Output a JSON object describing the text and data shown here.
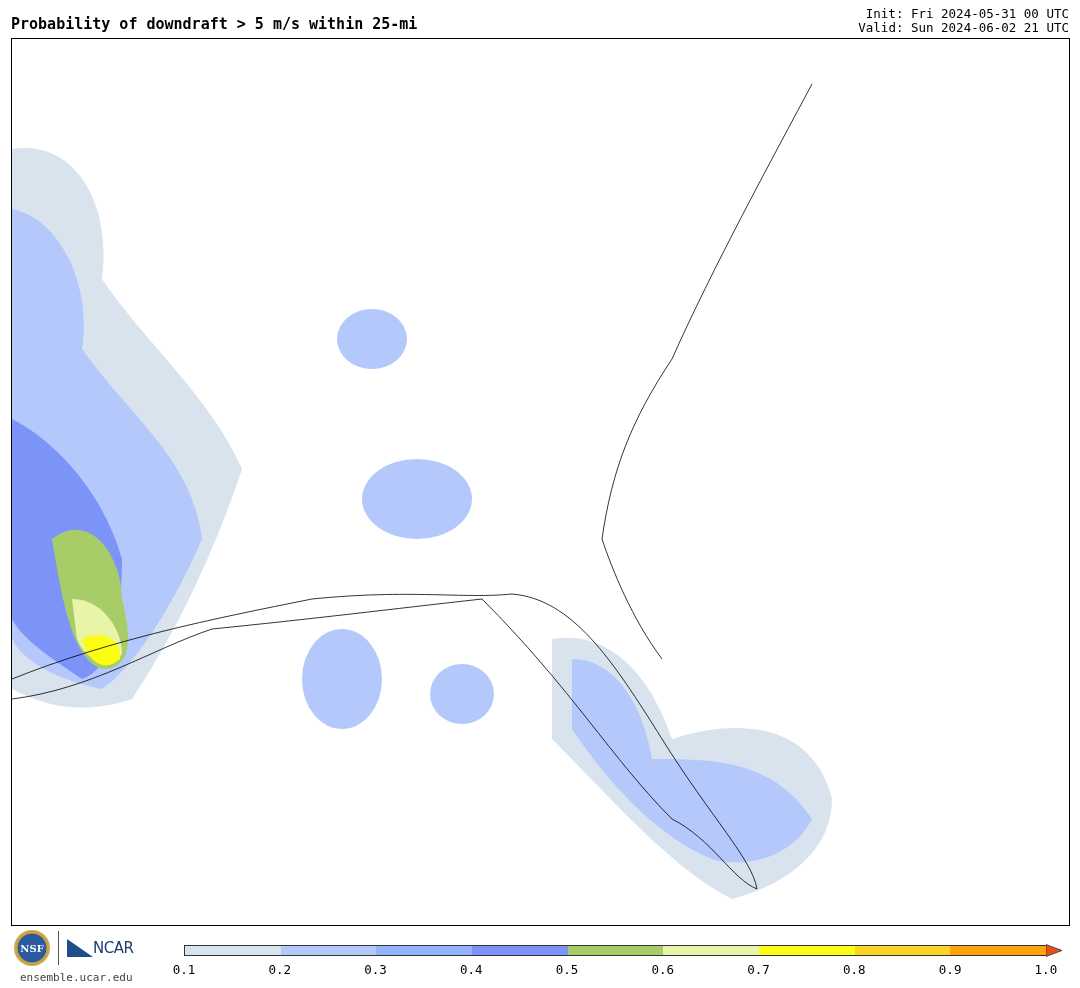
{
  "title": "Probability of downdraft > 5 m/s within 25-mi",
  "init": "Init: Fri 2024-05-31 00 UTC",
  "valid": "Valid: Sun 2024-06-02 21 UTC",
  "logos": {
    "nsf": "NSF",
    "ncar": "NCAR",
    "url": "ensemble.ucar.edu"
  },
  "colorbar": {
    "bins": [
      {
        "color": "#d9e3ee"
      },
      {
        "color": "#b4c8fc"
      },
      {
        "color": "#94b2fc"
      },
      {
        "color": "#7c94f8"
      },
      {
        "color": "#a8cd68"
      },
      {
        "color": "#e8f4a8"
      },
      {
        "color": "#fcfc14"
      },
      {
        "color": "#fcd424"
      },
      {
        "color": "#fca40c"
      },
      {
        "color": "#e8501a",
        "kind": "arrow"
      }
    ],
    "ticks": [
      "0.1",
      "0.2",
      "0.3",
      "0.4",
      "0.5",
      "0.6",
      "0.7",
      "0.8",
      "0.9",
      "1.0"
    ]
  }
}
